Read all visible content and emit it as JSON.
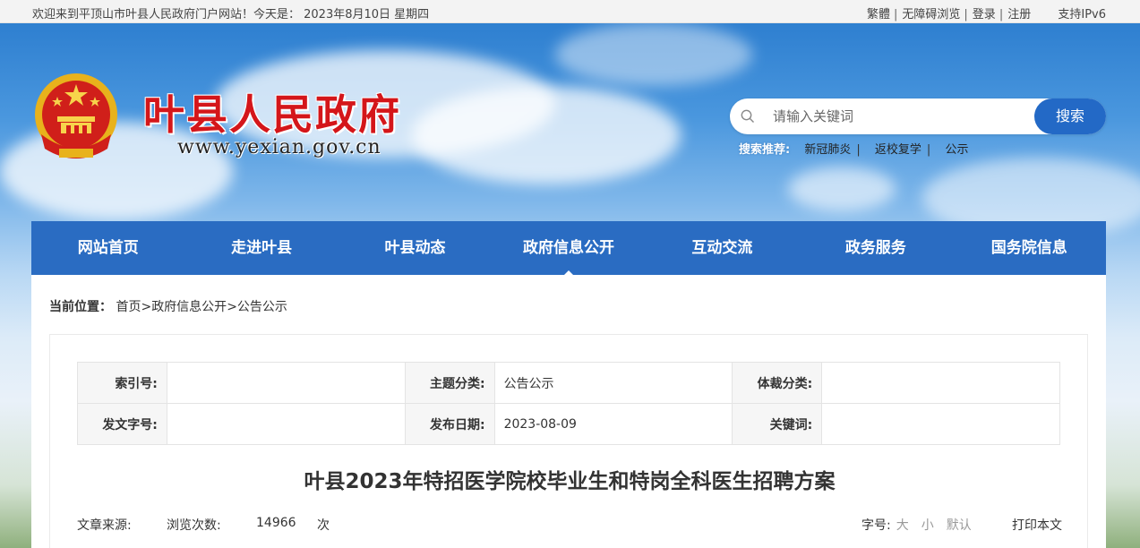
{
  "topbar": {
    "welcome": "欢迎来到平顶山市叶县人民政府门户网站！今天是： 2023年8月10日 星期四",
    "links": [
      "繁體",
      "无障碍浏览",
      "登录",
      "注册",
      "支持IPv6"
    ]
  },
  "header": {
    "title": "叶县人民政府",
    "url": "www.yexian.gov.cn"
  },
  "search": {
    "placeholder": "请输入关键词",
    "button": "搜索",
    "hot_label": "搜索推荐:",
    "hot_items": [
      "新冠肺炎",
      "返校复学",
      "公示"
    ]
  },
  "nav": {
    "items": [
      "网站首页",
      "走进叶县",
      "叶县动态",
      "政府信息公开",
      "互动交流",
      "政务服务",
      "国务院信息"
    ],
    "active_index": 3
  },
  "breadcrumb": {
    "label": "当前位置：",
    "items": [
      "首页",
      "政府信息公开",
      "公告公示"
    ],
    "sep": ">"
  },
  "meta": {
    "index_no_label": "索引号:",
    "index_no": "",
    "topic_label": "主题分类:",
    "topic": "公告公示",
    "genre_label": "体裁分类:",
    "genre": "",
    "doc_no_label": "发文字号:",
    "doc_no": "",
    "date_label": "发布日期:",
    "date": "2023-08-09",
    "keywords_label": "关键词:",
    "keywords": ""
  },
  "article": {
    "title": "叶县2023年特招医学院校毕业生和特岗全科医生招聘方案",
    "source_label": "文章来源:",
    "views_label": "浏览次数:",
    "views": "14966",
    "views_unit": "次",
    "fontsize_label": "字号:",
    "fontsize_large": "大",
    "fontsize_small": "小",
    "fontsize_default": "默认",
    "print": "打印本文"
  },
  "colors": {
    "nav": "#2a6cc2",
    "title_red": "#d4161a",
    "search_button": "#2369c6"
  }
}
